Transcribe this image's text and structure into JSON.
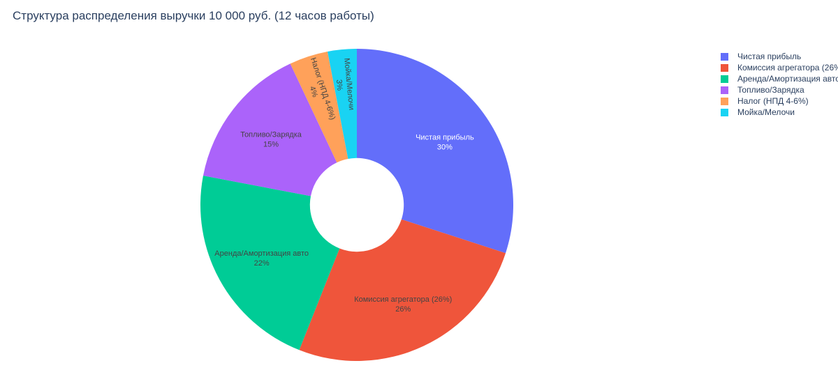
{
  "chart_data": {
    "type": "pie",
    "hole": 0.3,
    "title": "Структура распределения выручки 10 000 руб. (12 часов работы)",
    "labels": [
      "Чистая прибыль",
      "Комиссия агрегатора (26%)",
      "Аренда/Амортизация авто",
      "Топливо/Зарядка",
      "Налог (НПД 4-6%)",
      "Мойка/Мелочи"
    ],
    "values": [
      30,
      26,
      22,
      15,
      4,
      3
    ],
    "percent_labels": [
      "30%",
      "26%",
      "22%",
      "15%",
      "4%",
      "3%"
    ],
    "colors": [
      "#636efa",
      "#EF553B",
      "#00cc96",
      "#ab63fa",
      "#FFA15A",
      "#19d3f3"
    ],
    "label_colors": [
      "#ffffff",
      "#444444",
      "#444444",
      "#444444",
      "#444444",
      "#444444"
    ],
    "direction": "clockwise",
    "start": "top",
    "sort": "descending",
    "legend_position": "top-right"
  }
}
